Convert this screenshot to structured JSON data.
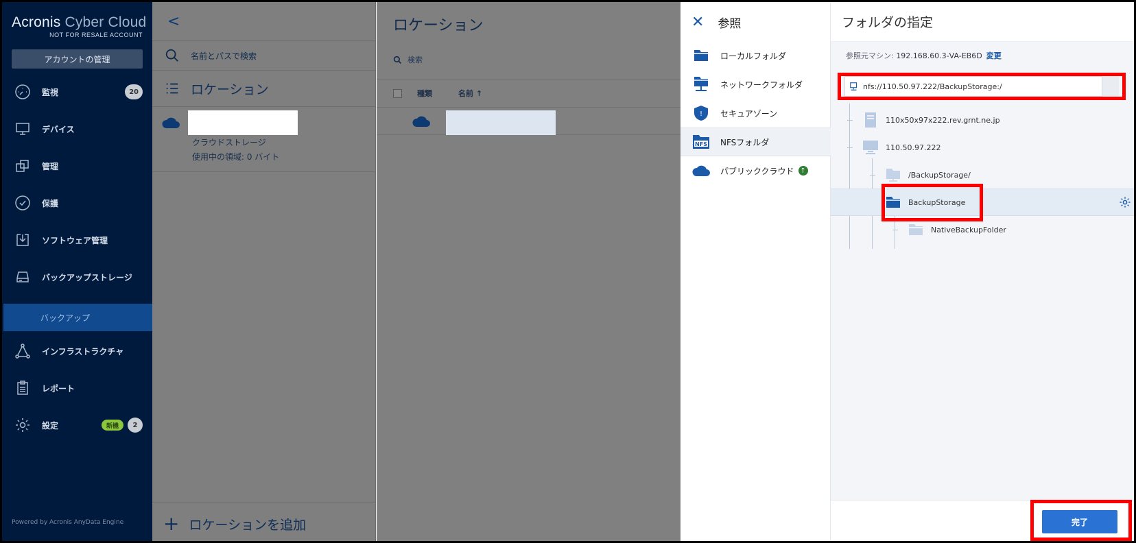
{
  "brand": {
    "name_bold": "Acronis",
    "name_light": " Cyber Cloud",
    "sub": "NOT FOR RESALE ACCOUNT"
  },
  "sidebar": {
    "account_button": "アカウントの管理",
    "items": [
      {
        "label": "監視",
        "icon": "gauge-icon",
        "badge": "20"
      },
      {
        "label": "デバイス",
        "icon": "monitor-icon"
      },
      {
        "label": "管理",
        "icon": "copy-icon"
      },
      {
        "label": "保護",
        "icon": "shield-check-icon"
      },
      {
        "label": "ソフトウェア管理",
        "icon": "software-download-icon"
      },
      {
        "label": "バックアップストレージ",
        "icon": "storage-drive-icon"
      },
      {
        "label": "インフラストラクチャ",
        "icon": "network-triangle-icon"
      },
      {
        "label": "レポート",
        "icon": "clipboard-icon"
      },
      {
        "label": "設定",
        "icon": "gear-icon",
        "badge_new": "新機",
        "badge": "2"
      }
    ],
    "subitem": "バックアップ",
    "powered_by": "Powered by Acronis AnyData Engine"
  },
  "locations_panel": {
    "back": "<",
    "search_placeholder": "名前とパスで検索",
    "title": "ロケーション",
    "item": {
      "type": "クラウドストレージ",
      "usage": "使用中の領域: 0 バイト"
    },
    "add_label": "ロケーションを追加"
  },
  "main": {
    "title": "ロケーション",
    "search_placeholder": "検索",
    "columns": {
      "type": "種類",
      "name": "名前 ↑"
    }
  },
  "browse": {
    "title": "参照",
    "items": [
      {
        "label": "ローカルフォルダ",
        "icon": "folder-icon"
      },
      {
        "label": "ネットワークフォルダ",
        "icon": "network-folder-icon"
      },
      {
        "label": "セキュアゾーン",
        "icon": "secure-zone-icon"
      },
      {
        "label": "NFSフォルダ",
        "icon": "nfs-icon",
        "selected": true
      },
      {
        "label": "パブリッククラウド",
        "icon": "cloud-icon",
        "upgrade": "↑"
      }
    ]
  },
  "folder": {
    "title": "フォルダの指定",
    "machine_label": "参照元マシン: ",
    "machine_value": "192.168.60.3-VA-EB6D",
    "change_link": "変更",
    "path": "nfs://110.50.97.222/BackupStorage:/",
    "tree": [
      {
        "label": "110x50x97x222.rev.grnt.ne.jp",
        "icon": "server-icon",
        "level": 0
      },
      {
        "label": "110.50.97.222",
        "icon": "computer-icon",
        "level": 0
      },
      {
        "label": "/BackupStorage/",
        "icon": "share-folder-icon",
        "level": 1
      },
      {
        "label": "BackupStorage",
        "icon": "folder-icon",
        "level": 1,
        "selected": true
      },
      {
        "label": "NativeBackupFolder",
        "icon": "folder-icon",
        "level": 2
      }
    ],
    "done_button": "完了"
  },
  "colors": {
    "nav_bg": "#001a3d",
    "accent": "#2a73d4",
    "highlight": "#ff0000",
    "nav_selected": "#124a8f"
  }
}
